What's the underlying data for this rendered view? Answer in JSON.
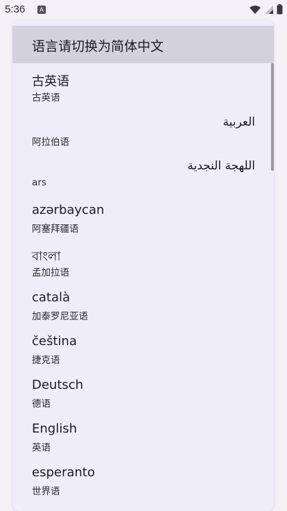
{
  "status_bar": {
    "time": "5:36",
    "notification_glyph": "A",
    "icons": [
      "wifi-icon",
      "signal-icon",
      "battery-icon"
    ]
  },
  "dialog": {
    "title": "语言请切换为简体中文",
    "items": [
      {
        "primary": "古英语",
        "secondary": "古英语",
        "rtl": false
      },
      {
        "primary": "العربية",
        "secondary": "阿拉伯语",
        "rtl": true
      },
      {
        "primary": "اللهجة النجدية",
        "secondary": "ars",
        "rtl": true
      },
      {
        "primary": "azərbaycan",
        "secondary": "阿塞拜疆语",
        "rtl": false
      },
      {
        "primary": "বাংলা",
        "secondary": "孟加拉语",
        "rtl": false
      },
      {
        "primary": "català",
        "secondary": "加泰罗尼亚语",
        "rtl": false
      },
      {
        "primary": "čeština",
        "secondary": "捷克语",
        "rtl": false
      },
      {
        "primary": "Deutsch",
        "secondary": "德语",
        "rtl": false
      },
      {
        "primary": "English",
        "secondary": "英语",
        "rtl": false
      },
      {
        "primary": "esperanto",
        "secondary": "世界语",
        "rtl": false
      }
    ]
  }
}
